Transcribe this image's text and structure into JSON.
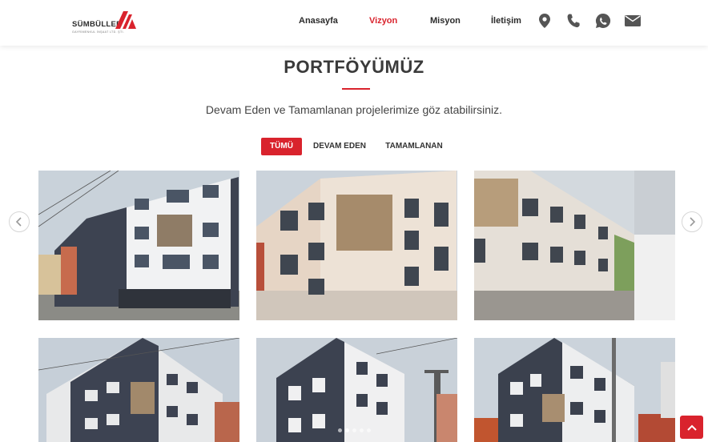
{
  "brand": {
    "name": "SÜMBÜLLER",
    "tagline": "GAYRİMENKUL İNŞAAT LTD. ŞTİ.",
    "accent": "#d9232d"
  },
  "nav": {
    "items": [
      {
        "label": "Anasayfa",
        "active": false
      },
      {
        "label": "Vizyon",
        "active": true
      },
      {
        "label": "Misyon",
        "active": false
      },
      {
        "label": "İletişim",
        "active": false
      }
    ],
    "icons": [
      "location-pin-icon",
      "phone-icon",
      "whatsapp-icon",
      "envelope-icon"
    ]
  },
  "section": {
    "title": "PORTFÖYÜMÜZ",
    "subtitle": "Devam Eden ve Tamamlanan projelerimize göz atabilirsiniz."
  },
  "filters": [
    {
      "label": "TÜMÜ",
      "active": true
    },
    {
      "label": "DEVAM EDEN",
      "active": false
    },
    {
      "label": "TAMAMLANAN",
      "active": false
    }
  ],
  "carousel": {
    "prev_icon": "chevron-left-icon",
    "next_icon": "chevron-right-icon",
    "dot_count": 5,
    "active_dot": 1
  },
  "projects": [
    {
      "image": "apartment-building-photo"
    },
    {
      "image": "apartment-building-photo"
    },
    {
      "image": "apartment-building-photo"
    },
    {
      "image": "apartment-building-photo"
    },
    {
      "image": "apartment-building-photo"
    },
    {
      "image": "apartment-building-photo"
    }
  ],
  "scroll_top_icon": "chevron-up-icon"
}
